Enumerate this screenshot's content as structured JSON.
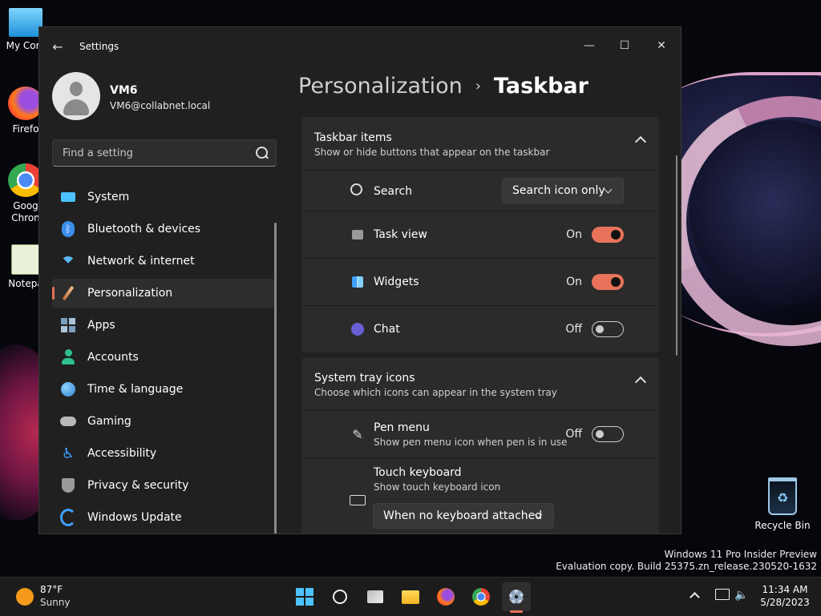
{
  "desktop": {
    "icons": [
      {
        "label": "My Com",
        "icon": "computer-icon"
      },
      {
        "label": "Firefo",
        "icon": "firefox-icon"
      },
      {
        "label": "Goog Chron",
        "icon": "chrome-icon"
      },
      {
        "label": "Notepa",
        "icon": "notepad-icon"
      }
    ],
    "recycle_bin": "Recycle Bin",
    "watermark_line1": "Windows 11 Pro Insider Preview",
    "watermark_line2": "Evaluation copy. Build 25375.zn_release.230520-1632"
  },
  "window": {
    "title": "Settings",
    "controls": {
      "minimize": "—",
      "maximize": "☐",
      "close": "✕"
    }
  },
  "user": {
    "name": "VM6",
    "email": "VM6@collabnet.local"
  },
  "search": {
    "placeholder": "Find a setting"
  },
  "nav": [
    {
      "label": "System",
      "icon": "system-icon",
      "color": "#4cc2ff"
    },
    {
      "label": "Bluetooth & devices",
      "icon": "bluetooth-icon",
      "color": "#3b8eea"
    },
    {
      "label": "Network & internet",
      "icon": "wifi-icon",
      "color": "#5ab4f0"
    },
    {
      "label": "Personalization",
      "icon": "brush-icon",
      "color": "#e8a36a",
      "active": true
    },
    {
      "label": "Apps",
      "icon": "apps-icon",
      "color": "#7b9fbd"
    },
    {
      "label": "Accounts",
      "icon": "accounts-icon",
      "color": "#2fbf8f"
    },
    {
      "label": "Time & language",
      "icon": "globe-icon",
      "color": "#3fa7e0"
    },
    {
      "label": "Gaming",
      "icon": "gamepad-icon",
      "color": "#b8b8b8"
    },
    {
      "label": "Accessibility",
      "icon": "accessibility-icon",
      "color": "#3ea0ff"
    },
    {
      "label": "Privacy & security",
      "icon": "shield-icon",
      "color": "#9a9a9a"
    },
    {
      "label": "Windows Update",
      "icon": "update-icon",
      "color": "#3ea0ff"
    }
  ],
  "breadcrumb": {
    "parent": "Personalization",
    "separator": "›",
    "current": "Taskbar"
  },
  "taskbar_items": {
    "title": "Taskbar items",
    "subtitle": "Show or hide buttons that appear on the taskbar",
    "search": {
      "label": "Search",
      "value": "Search icon only"
    },
    "rows": [
      {
        "label": "Task view",
        "state": "On"
      },
      {
        "label": "Widgets",
        "state": "On"
      },
      {
        "label": "Chat",
        "state": "Off"
      }
    ]
  },
  "system_tray": {
    "title": "System tray icons",
    "subtitle": "Choose which icons can appear in the system tray",
    "pen": {
      "label": "Pen menu",
      "desc": "Show pen menu icon when pen is in use",
      "state": "Off"
    },
    "touch": {
      "label": "Touch keyboard",
      "desc": "Show touch keyboard icon",
      "value": "When no keyboard attached"
    }
  },
  "taskbar": {
    "weather": {
      "temp": "87°F",
      "condition": "Sunny"
    },
    "clock": {
      "time": "11:34 AM",
      "date": "5/28/2023"
    }
  }
}
